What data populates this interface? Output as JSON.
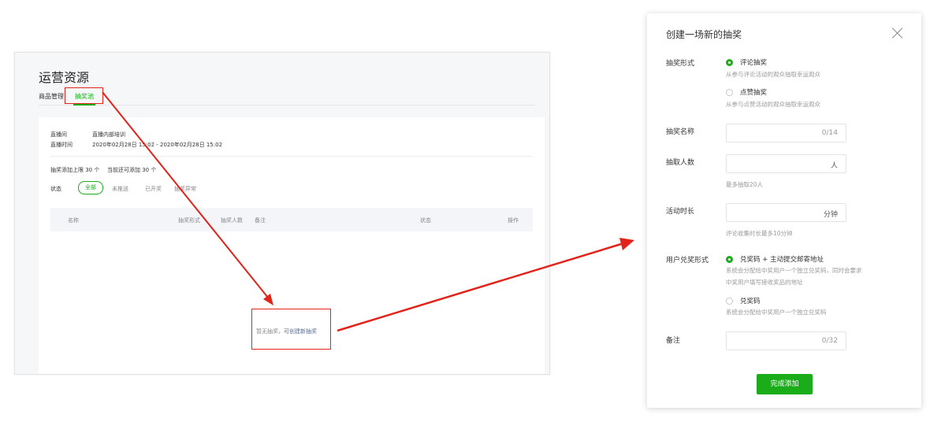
{
  "left": {
    "page_title": "运营资源",
    "tabs": [
      "商品管理",
      "抽奖池"
    ],
    "info": {
      "room_label": "直播间",
      "room_value": "直播内部培训",
      "time_label": "直播时间",
      "time_value": "2020年02月28日 15:02 - 2020年02月28日 15:02"
    },
    "limit_text": "抽奖添加上限 30 个",
    "remain_text": "当前还可添加 30 个",
    "status_label": "状态",
    "filters": [
      "全部",
      "未推送",
      "已开奖",
      "抽奖异常"
    ],
    "columns": [
      "名称",
      "抽奖形式",
      "抽奖人数",
      "备注",
      "状态",
      "操作"
    ],
    "empty": {
      "text": "暂无抽奖，",
      "link": "可创建新抽奖"
    }
  },
  "dialog": {
    "title": "创建一场新的抽奖",
    "form_label": "抽奖形式",
    "form_options": [
      {
        "label": "评论抽奖",
        "desc": "从参与评论活动的观众抽取幸运观众",
        "selected": true
      },
      {
        "label": "点赞抽奖",
        "desc": "从参与点赞活动的观众抽取幸运观众",
        "selected": false
      }
    ],
    "name_label": "抽奖名称",
    "name_counter": "0/14",
    "count_label": "抽取人数",
    "count_unit": "人",
    "count_hint": "最多抽取20人",
    "duration_label": "活动时长",
    "duration_unit": "分钟",
    "duration_hint": "评论收集时长最多10分钟",
    "redeem_label": "用户兑奖形式",
    "redeem_options": [
      {
        "label": "兑奖码 + 主动提交邮寄地址",
        "desc_line1": "系统会分配给中奖用户一个独立兑奖码，同时会要求",
        "desc_line2": "中奖用户填写接收奖品的地址",
        "selected": true
      },
      {
        "label": "兑奖码",
        "desc_line1": "系统会分配给中奖用户一个独立兑奖码",
        "selected": false
      }
    ],
    "remark_label": "备注",
    "remark_counter": "0/32",
    "submit_label": "完成添加"
  },
  "colors": {
    "accent": "#1aad19",
    "highlight": "#e2231a",
    "link": "#576b95"
  },
  "icons": [
    "close-icon",
    "arrow-icon"
  ]
}
